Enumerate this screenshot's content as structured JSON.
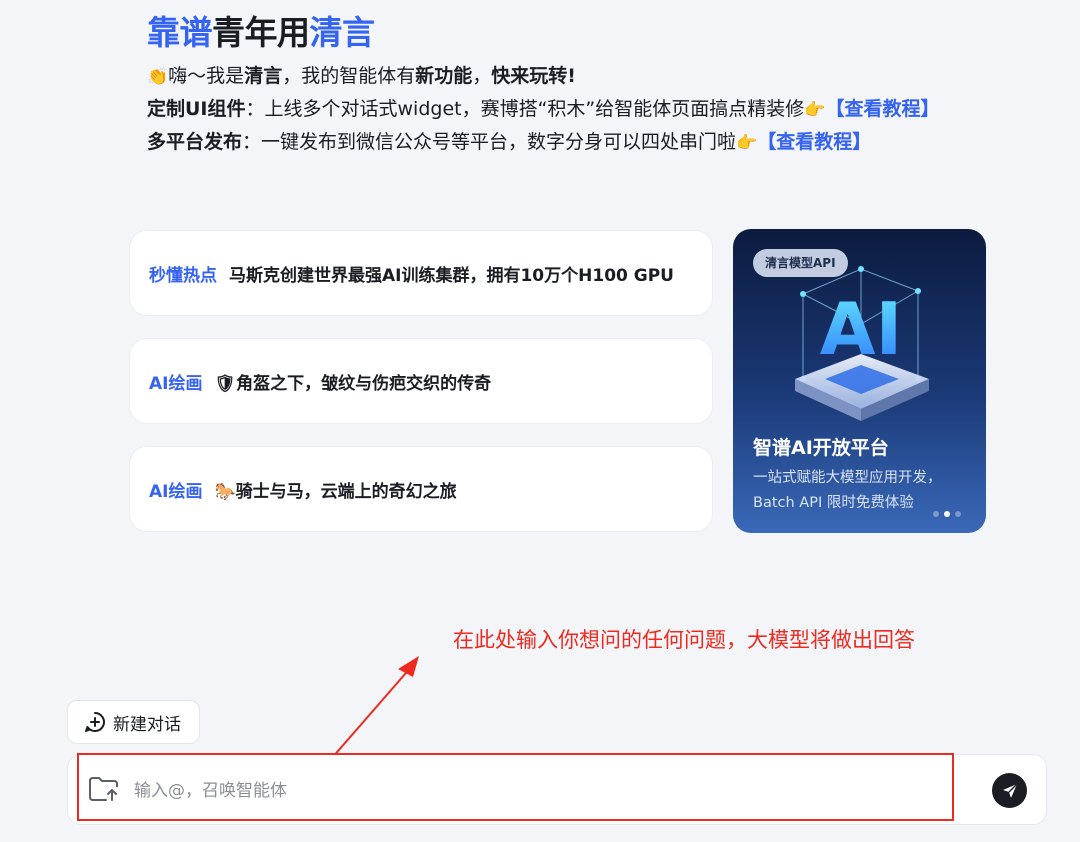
{
  "hero": {
    "title_part1": "靠谱",
    "title_part2": "青年用",
    "title_part3": "清言",
    "line1": {
      "emoji": "👏",
      "text1": "嗨～我是",
      "name": "清言",
      "text2": "，我的智能体有",
      "feature": "新功能",
      "text3": "，",
      "cta": "快来玩转!"
    },
    "line2": {
      "label": "定制UI组件",
      "text": "：上线多个对话式widget，赛博搭“积木”给智能体页面搞点精装修",
      "emoji": "👉",
      "link": "【查看教程】"
    },
    "line3": {
      "label": "多平台发布",
      "text": "：一键发布到微信公众号等平台，数字分身可以四处串门啦",
      "emoji": "👉",
      "link": "【查看教程】"
    }
  },
  "cards": [
    {
      "tag": "秒懂热点",
      "title": "马斯克创建世界最强AI训练集群，拥有10万个H100 GPU"
    },
    {
      "tag": "AI绘画",
      "title": "🛡角盔之下，皱纹与伤疤交织的传奇"
    },
    {
      "tag": "AI绘画",
      "title": "🐎骑士与马，云端上的奇幻之旅"
    }
  ],
  "promo": {
    "badge": "清言模型API",
    "art_text": "AI",
    "title": "智谱AI开放平台",
    "subtitle": "一站式赋能大模型应用开发，Batch API 限时免费体验",
    "active_slide": 2,
    "slide_count": 3
  },
  "annotation": {
    "text": "在此处输入你想问的任何问题，大模型将做出回答",
    "color": "#ee2a20"
  },
  "new_chat": {
    "label": "新建对话",
    "icon": "plus-chat-icon"
  },
  "input": {
    "placeholder": "输入@，召唤智能体",
    "value": "",
    "attach_icon": "folder-upload-icon",
    "send_icon": "send-icon"
  },
  "colors": {
    "accent": "#3563f2",
    "text": "#1b1d24",
    "background": "#f4f5f8",
    "annotation": "#ee2a20"
  }
}
